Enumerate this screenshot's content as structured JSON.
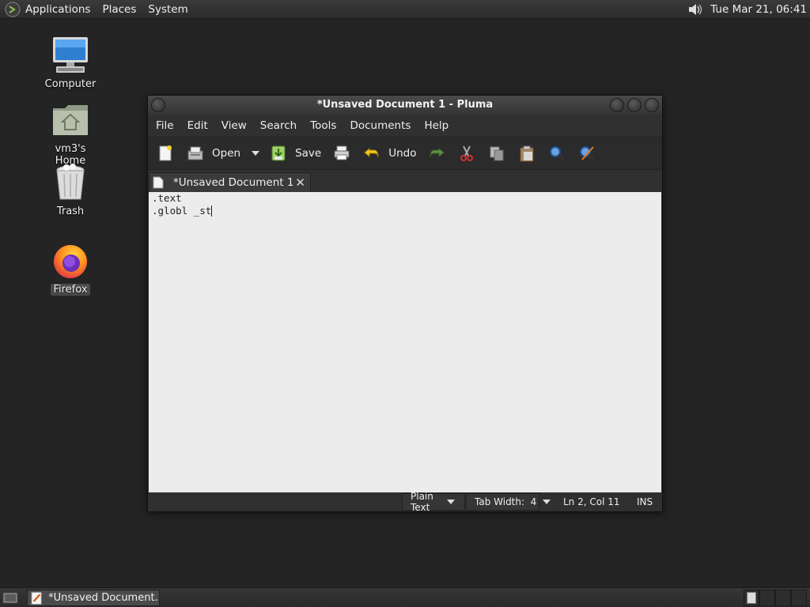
{
  "top_panel": {
    "menus": [
      "Applications",
      "Places",
      "System"
    ],
    "clock": "Tue Mar 21, 06:41"
  },
  "desktop": {
    "icons": [
      {
        "label": "Computer",
        "icon": "computer-icon"
      },
      {
        "label": "vm3's Home",
        "icon": "home-folder-icon"
      },
      {
        "label": "Trash",
        "icon": "trash-icon"
      },
      {
        "label": "Firefox",
        "icon": "firefox-icon"
      }
    ]
  },
  "window": {
    "title": "*Unsaved Document 1 - Pluma",
    "menubar": [
      "File",
      "Edit",
      "View",
      "Search",
      "Tools",
      "Documents",
      "Help"
    ],
    "toolbar": {
      "open_label": "Open",
      "save_label": "Save",
      "undo_label": "Undo"
    },
    "tab": {
      "label": "*Unsaved Document 1"
    },
    "editor": {
      "lines": [
        ".text",
        ".globl _st"
      ]
    },
    "statusbar": {
      "syntax": "Plain Text",
      "tab_width": "Tab Width:  4",
      "position": "Ln 2, Col 11",
      "mode": "INS"
    }
  },
  "bottom_panel": {
    "task_label": "*Unsaved Document..."
  },
  "colors": {
    "desktop_bg": "#242424",
    "editor_bg": "#ececec",
    "panel_bg": "#2c2c2c"
  }
}
